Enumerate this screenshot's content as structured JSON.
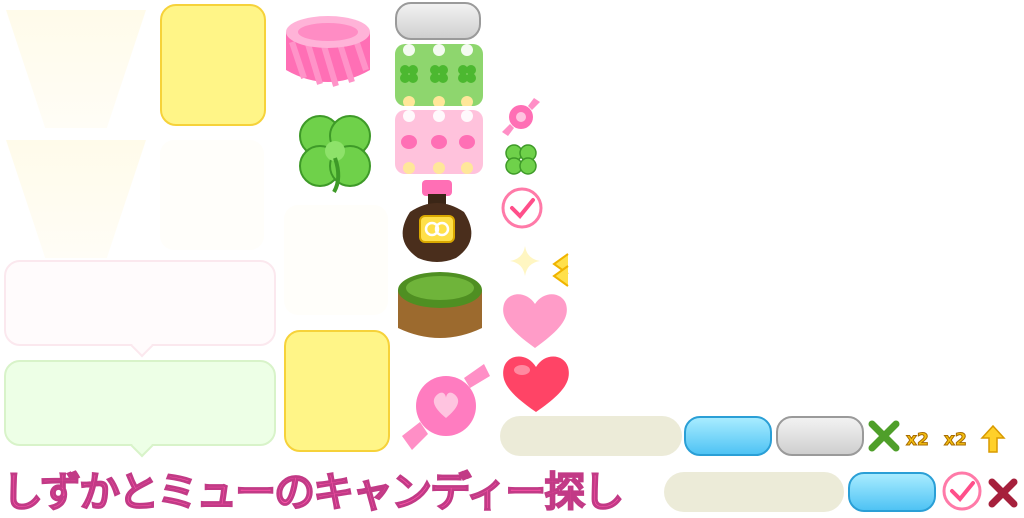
{
  "title": "しずかとミューのキャンディー探し",
  "multipliers": [
    "x2",
    "x2"
  ],
  "colors": {
    "title_pink": "#ff55aa",
    "panel_yellow": "#fff587",
    "button_blue": "#4fc3f4",
    "button_gray": "#cfcfcf",
    "clover_green": "#5cc43a",
    "heart_pink": "#ff9cc8",
    "heart_red": "#ff4466",
    "cross_green": "#4f9f2a",
    "cross_red": "#a6203c"
  },
  "icons": [
    "light-beam",
    "yellow-panel",
    "pink-gift-box",
    "four-leaf-clover",
    "board-tiles",
    "candy",
    "check-mark",
    "perfume-bottle",
    "sparkle",
    "arrow",
    "heart",
    "grass-cake",
    "wrapped-candy",
    "cross",
    "up-arrow"
  ]
}
